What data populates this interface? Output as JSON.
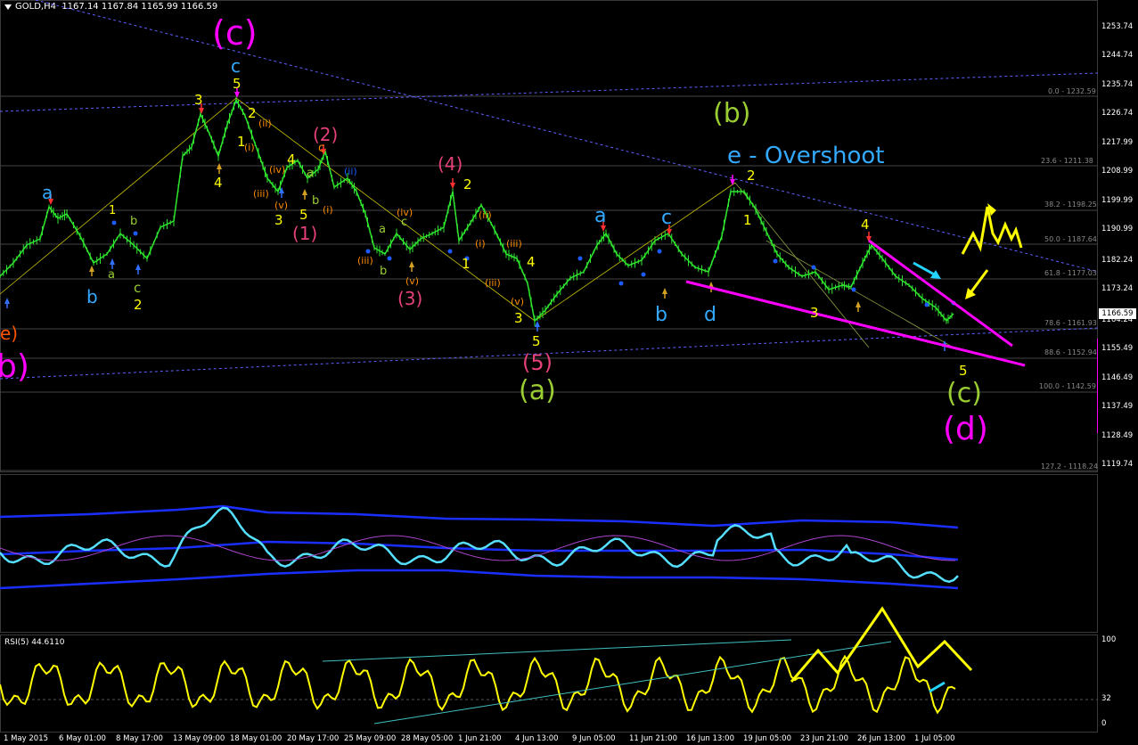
{
  "header": {
    "symbol_title": "GOLD,H4",
    "ohlc": "1167.14 1167.84 1165.99 1166.59"
  },
  "rsi": {
    "title": "RSI(5) 44.6110"
  },
  "current_price": "1166.59",
  "price_ticks": [
    "1253.74",
    "1244.74",
    "1235.74",
    "1226.74",
    "1217.99",
    "1208.99",
    "1199.99",
    "1190.99",
    "1182.24",
    "1173.24",
    "1164.24",
    "1155.49",
    "1146.49",
    "1137.49",
    "1128.49",
    "1119.74"
  ],
  "rsi_ticks": [
    "100",
    "32",
    "0"
  ],
  "fib_levels": [
    "0.0 - 1232.59",
    "23.6 - 1211.38",
    "38.2 - 1198.25",
    "50.0 - 1187.64",
    "61.8 - 1177.03",
    "78.6 - 1161.93",
    "88.6 - 1152.94",
    "100.0 - 1142.59",
    "127.2 - 1118.24"
  ],
  "dates": [
    "1 May 2015",
    "6 May 01:00",
    "8 May 17:00",
    "13 May 09:00",
    "18 May 01:00",
    "20 May 17:00",
    "25 May 09:00",
    "28 May 05:00",
    "1 Jun 21:00",
    "4 Jun 13:00",
    "9 Jun 05:00",
    "11 Jun 21:00",
    "16 Jun 13:00",
    "19 Jun 05:00",
    "23 Jun 21:00",
    "26 Jun 13:00",
    "1 Jul 05:00"
  ],
  "wave_labels": {
    "c_big": "(c)",
    "c_blue": "c",
    "five_top": "5",
    "three_top": "3",
    "two_a": "2",
    "one_a": "1",
    "four_a": "4",
    "i_1": "(i)",
    "ii_1": "(ii)",
    "iii_1": "(iii)",
    "iv_1": "(iv)",
    "v_1": "(v)",
    "three_b": "3",
    "five_b": "5",
    "b_small": "b",
    "a_small": "a",
    "paren1": "(1)",
    "paren2": "(2)",
    "c_orange": "c",
    "i_2": "(i)",
    "ii_2": "(ii)",
    "a_blue_left": "a",
    "one_left": "1",
    "b_left": "b",
    "b_blue_left": "b",
    "a_left": "a",
    "c_left": "c",
    "two_left": "2",
    "a_mid": "a",
    "b_mid": "b",
    "c_mid": "c",
    "iii_2": "(iii)",
    "iv_2": "(iv)",
    "v_2": "(v)",
    "paren3": "(3)",
    "paren4": "(4)",
    "two_mid": "2",
    "ii_3": "(ii)",
    "i_3": "(i)",
    "iii_3": "(iii)",
    "one_mid": "1",
    "iii_4": "(iii)",
    "v_3": "(v)",
    "four_mid": "4",
    "three_mid": "3",
    "five_mid": "5",
    "paren5": "(5)",
    "a_paren": "(a)",
    "a_blue_mid": "a",
    "c_blue_mid": "c",
    "b_blue_mid": "b",
    "d_blue": "d",
    "b_paren": "(b)",
    "overshoot": "e - Overshoot",
    "two_right": "2",
    "one_right": "1",
    "three_right": "3",
    "four_right": "4",
    "five_right": "5",
    "c_paren": "(c)",
    "d_paren": "(d)",
    "e_left": "e)",
    "b_left_edge": "b)"
  },
  "colors": {
    "candles": "#2ee62e",
    "trend_yellow": "#ffff00",
    "magenta": "#ff00ff",
    "cyan": "#33ccff",
    "olive": "#9acd32",
    "crimson": "#e4407a",
    "orange": "#ff8c00",
    "blue": "#1e5bff"
  }
}
